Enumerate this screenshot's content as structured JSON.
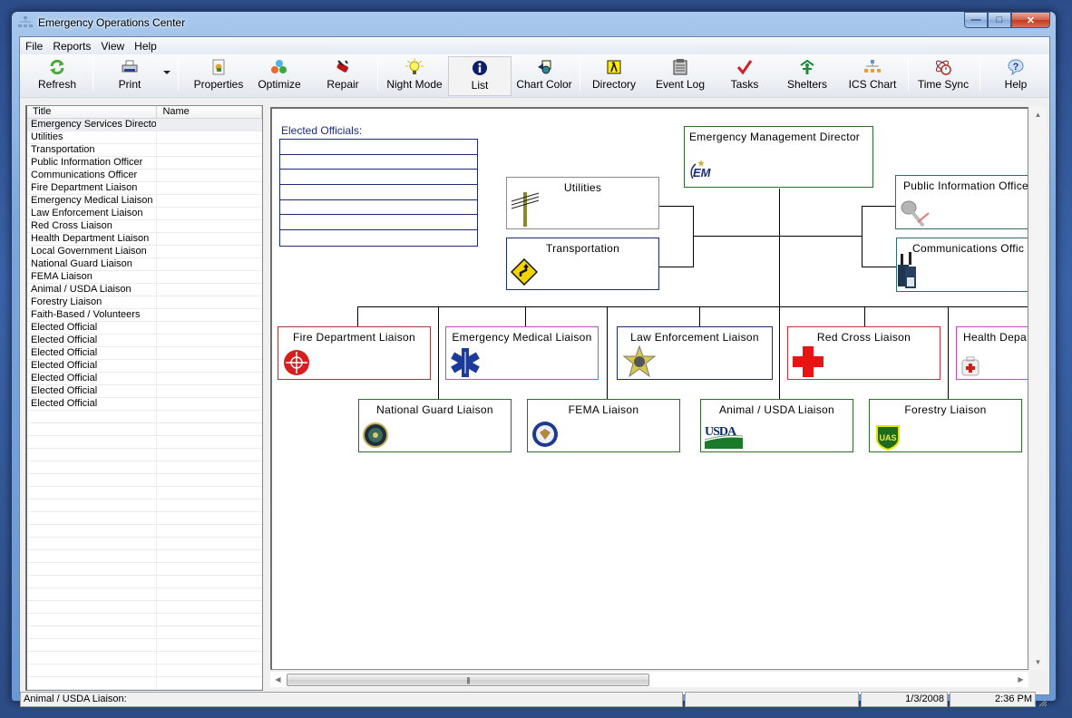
{
  "window": {
    "title": "Emergency Operations Center",
    "controls": {
      "minimize": "—",
      "maximize": "□",
      "close": "✕"
    }
  },
  "menubar": {
    "items": [
      "File",
      "Reports",
      "View",
      "Help"
    ]
  },
  "toolbar": {
    "buttons": [
      {
        "label": "Refresh",
        "icon": "refresh-icon"
      },
      {
        "label": "Print",
        "icon": "printer-icon"
      },
      {
        "label": "Properties",
        "icon": "properties-icon"
      },
      {
        "label": "Optimize",
        "icon": "optimize-icon"
      },
      {
        "label": "Repair",
        "icon": "repair-icon"
      },
      {
        "label": "Night Mode",
        "icon": "lightbulb-icon"
      },
      {
        "label": "List",
        "icon": "info-icon",
        "active": true
      },
      {
        "label": "Chart Color",
        "icon": "paint-bucket-icon"
      },
      {
        "label": "Directory",
        "icon": "directory-icon"
      },
      {
        "label": "Event Log",
        "icon": "event-log-icon"
      },
      {
        "label": "Tasks",
        "icon": "checkmark-icon"
      },
      {
        "label": "Shelters",
        "icon": "shelter-icon"
      },
      {
        "label": "ICS Chart",
        "icon": "org-chart-icon"
      },
      {
        "label": "Time Sync",
        "icon": "clock-icon"
      },
      {
        "label": "Help",
        "icon": "help-icon"
      }
    ]
  },
  "list": {
    "columns": [
      "Title",
      "Name"
    ],
    "rows": [
      {
        "title": "Emergency Services Director",
        "name": ""
      },
      {
        "title": "Utilities",
        "name": ""
      },
      {
        "title": "Transportation",
        "name": ""
      },
      {
        "title": "Public Information Officer",
        "name": ""
      },
      {
        "title": "Communications Officer",
        "name": ""
      },
      {
        "title": "Fire Department Liaison",
        "name": ""
      },
      {
        "title": "Emergency Medical Liaison",
        "name": ""
      },
      {
        "title": "Law Enforcement Liaison",
        "name": ""
      },
      {
        "title": "Red Cross Liaison",
        "name": ""
      },
      {
        "title": "Health Department Liaison",
        "name": ""
      },
      {
        "title": "Local Government Liaison",
        "name": ""
      },
      {
        "title": "National Guard Liaison",
        "name": ""
      },
      {
        "title": "FEMA Liaison",
        "name": ""
      },
      {
        "title": "Animal / USDA Liaison",
        "name": ""
      },
      {
        "title": "Forestry Liaison",
        "name": ""
      },
      {
        "title": "Faith-Based / Volunteers",
        "name": ""
      },
      {
        "title": "Elected Official",
        "name": ""
      },
      {
        "title": "Elected Official",
        "name": ""
      },
      {
        "title": "Elected Official",
        "name": ""
      },
      {
        "title": "Elected Official",
        "name": ""
      },
      {
        "title": "Elected Official",
        "name": ""
      },
      {
        "title": "Elected Official",
        "name": ""
      },
      {
        "title": "Elected Official",
        "name": ""
      }
    ],
    "empty_rows": 22
  },
  "chart": {
    "elected_label": "Elected Officials:",
    "elected_rows": 7,
    "nodes": {
      "director": {
        "title": "Emergency Management Director",
        "border": "#2e6b2e",
        "icon": "em-logo-icon"
      },
      "utilities": {
        "title": "Utilities",
        "border": "#8c8c8c",
        "icon": "utility-pole-icon"
      },
      "transportation": {
        "title": "Transportation",
        "border": "#1c2a6e",
        "icon": "road-sign-icon"
      },
      "pio": {
        "title": "Public Information Office",
        "border": "#2e6b6b",
        "icon": "microphone-icon"
      },
      "comms": {
        "title": "Communications Offic",
        "border": "#2e6b6b",
        "icon": "radio-icon"
      },
      "fire": {
        "title": "Fire Department Liaison",
        "border": "#a33a3a",
        "icon": "fire-maltese-cross-icon"
      },
      "ems": {
        "title": "Emergency Medical Liaison",
        "border": "#cc44cc",
        "icon": "star-of-life-icon"
      },
      "law": {
        "title": "Law Enforcement Liaison",
        "border": "#1c2a6e",
        "icon": "sheriff-badge-icon"
      },
      "redcross": {
        "title": "Red Cross Liaison",
        "border": "#c83434",
        "icon": "red-cross-icon"
      },
      "health": {
        "title": "Health Depa",
        "border": "#cc44cc",
        "icon": "first-aid-kit-icon"
      },
      "guard": {
        "title": "National Guard Liaison",
        "border": "#2e6b2e",
        "icon": "national-guard-seal-icon"
      },
      "fema": {
        "title": "FEMA Liaison",
        "border": "#2e6b2e",
        "icon": "fema-seal-icon"
      },
      "usda": {
        "title": "Animal / USDA Liaison",
        "border": "#2e6b2e",
        "icon": "usda-logo-icon",
        "logo_text": "USDA"
      },
      "forestry": {
        "title": "Forestry Liaison",
        "border": "#2e6b2e",
        "icon": "forest-service-shield-icon",
        "logo_text": "UAS"
      }
    }
  },
  "statusbar": {
    "message": "Animal / USDA Liaison:",
    "panel2": "",
    "date": "1/3/2008",
    "time": "2:36 PM"
  }
}
